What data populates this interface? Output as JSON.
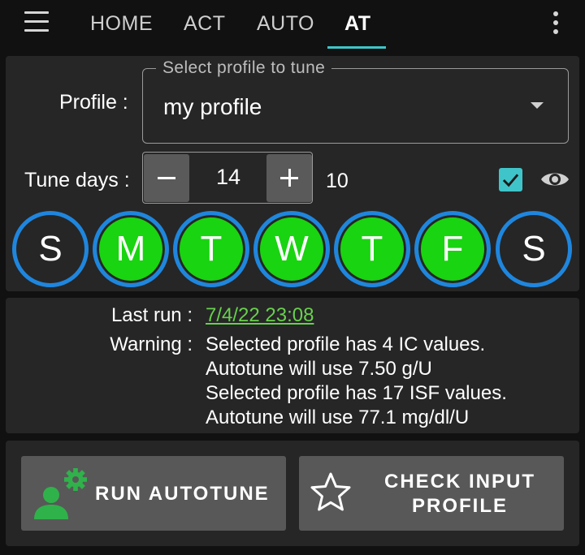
{
  "appbar": {
    "menu_icon": "hamburger-menu-icon",
    "tabs": [
      {
        "label": "HOME",
        "active": false
      },
      {
        "label": "ACT",
        "active": false
      },
      {
        "label": "AUTO",
        "active": false
      },
      {
        "label": "AT",
        "active": true
      }
    ],
    "overflow_icon": "more-vert-icon",
    "accent_color": "#3fc5c9"
  },
  "profile": {
    "label": "Profile :",
    "legend": "Select profile to tune",
    "value": "my profile"
  },
  "tune_days": {
    "label": "Tune days :",
    "value": "14",
    "count": "10",
    "checkbox_checked": true
  },
  "weekdays": [
    {
      "letter": "S",
      "selected": false
    },
    {
      "letter": "M",
      "selected": true
    },
    {
      "letter": "T",
      "selected": true
    },
    {
      "letter": "W",
      "selected": true
    },
    {
      "letter": "T",
      "selected": true
    },
    {
      "letter": "F",
      "selected": true
    },
    {
      "letter": "S",
      "selected": false
    }
  ],
  "colors": {
    "selected_day": "#19d410",
    "day_ring": "#1f86de",
    "last_run_link": "#67d14c"
  },
  "info": {
    "last_run_label": "Last run :",
    "last_run_value": "7/4/22 23:08",
    "warning_label": "Warning :",
    "warning_lines": [
      "Selected profile has 4 IC values.",
      "Autotune will use 7.50 g/U",
      "Selected profile has 17 ISF values.",
      "Autotune will use 77.1 mg/dl/U"
    ]
  },
  "buttons": {
    "run_autotune": "RUN AUTOTUNE",
    "check_input_line1": "CHECK INPUT",
    "check_input_line2": "PROFILE"
  }
}
